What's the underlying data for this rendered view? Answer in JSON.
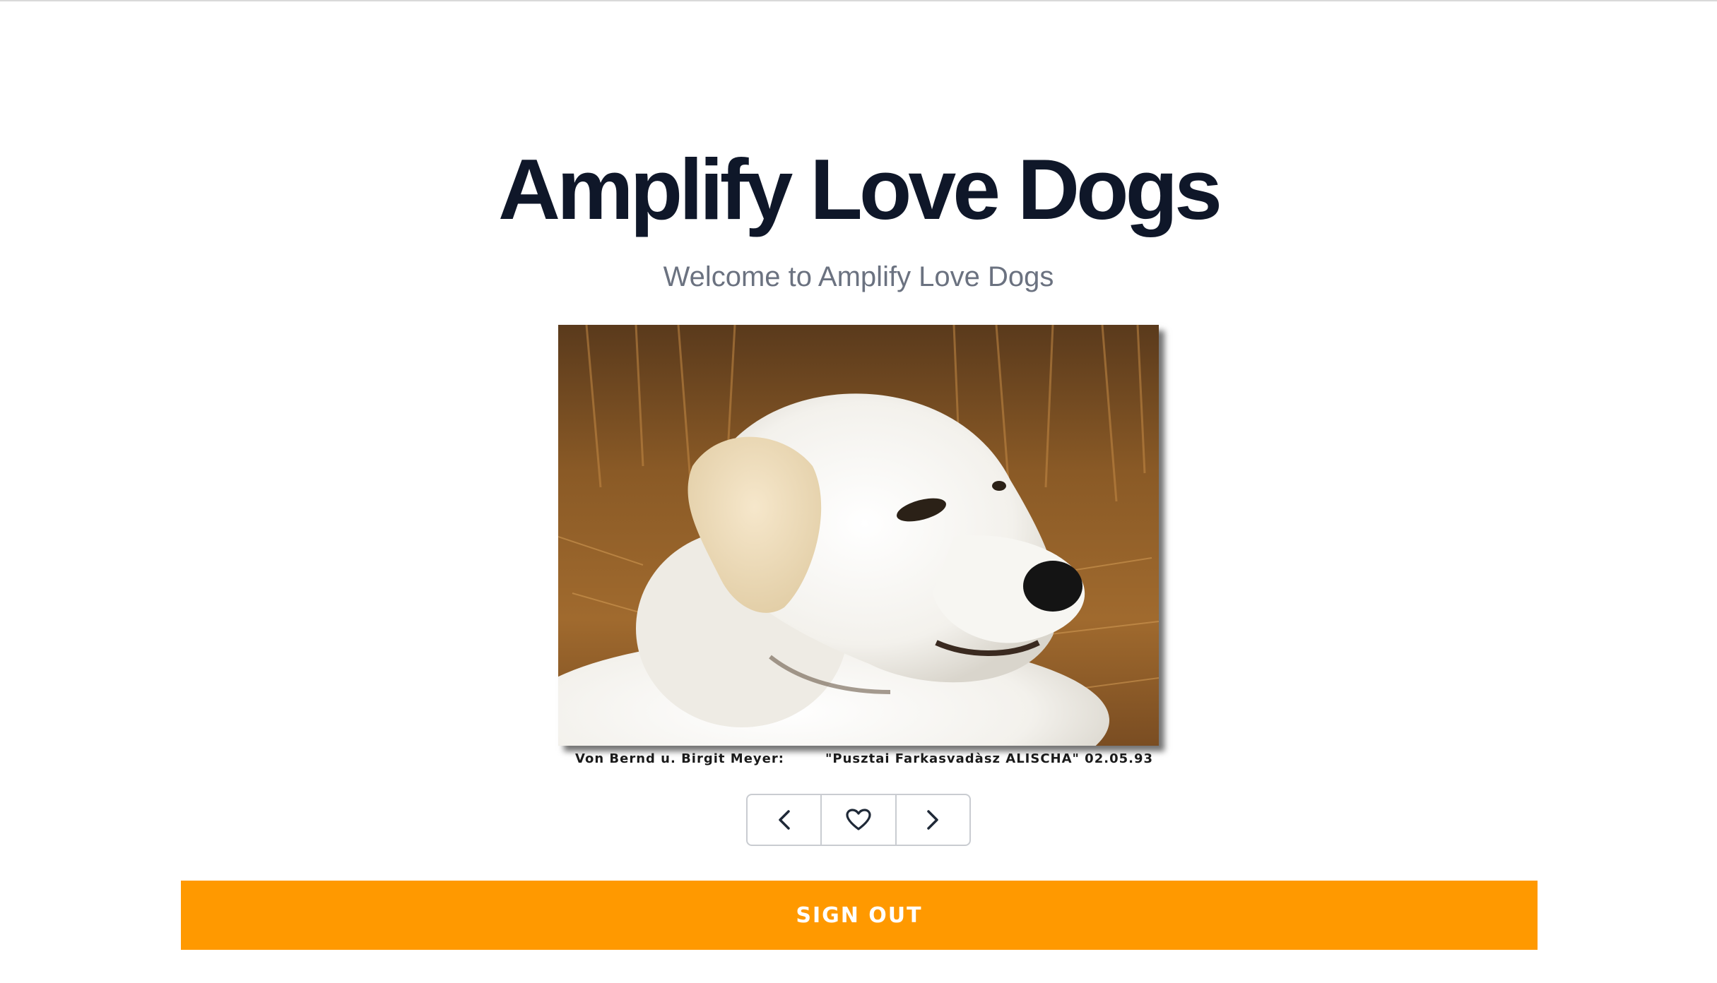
{
  "header": {
    "title": "Amplify Love Dogs",
    "subtitle": "Welcome to Amplify Love Dogs"
  },
  "photo": {
    "caption": "Von Bernd u. Birgit Meyer:        \"Pusztai Farkasvadàsz ALISCHA\" 02.05.93"
  },
  "controls": {
    "previous_icon": "chevron-left-icon",
    "like_icon": "heart-outline-icon",
    "next_icon": "chevron-right-icon"
  },
  "actions": {
    "sign_out_label": "SIGN OUT"
  },
  "colors": {
    "accent": "#ff9900",
    "title": "#0f1729",
    "subtitle": "#6b7280"
  }
}
